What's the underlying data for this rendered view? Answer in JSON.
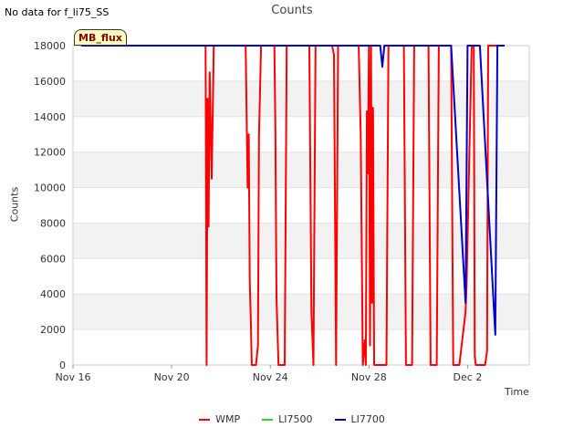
{
  "header": {
    "nodata_text": "No data for f_li75_SS",
    "badge": "MB_flux"
  },
  "colors": {
    "WMP": "#ff0000",
    "LI7500": "#22dd22",
    "LI7700": "#0000cc"
  },
  "chart_data": {
    "type": "line",
    "title": "Counts",
    "xlabel": "Time",
    "ylabel": "Counts",
    "xlim": [
      "2023-11-16",
      "2023-12-04T12:00"
    ],
    "ylim": [
      0,
      18000
    ],
    "yticks": [
      0,
      2000,
      4000,
      6000,
      8000,
      10000,
      12000,
      14000,
      16000,
      18000
    ],
    "xticks": [
      {
        "value": "2023-11-16",
        "label": "Nov 16"
      },
      {
        "value": "2023-11-20",
        "label": "Nov 20"
      },
      {
        "value": "2023-11-24",
        "label": "Nov 24"
      },
      {
        "value": "2023-11-28",
        "label": "Nov 28"
      },
      {
        "value": "2023-12-02",
        "label": "Dec 2"
      }
    ],
    "grid": "horizontal bands",
    "legend": "bottom",
    "series": [
      {
        "name": "WMP",
        "points": [
          [
            "2023-11-16T08:00",
            18000
          ],
          [
            "2023-11-21T09:00",
            18000
          ],
          [
            "2023-11-21T10:00",
            0
          ],
          [
            "2023-11-21T11:00",
            15000
          ],
          [
            "2023-11-21T12:00",
            7800
          ],
          [
            "2023-11-21T13:00",
            16500
          ],
          [
            "2023-11-21T15:00",
            10500
          ],
          [
            "2023-11-21T17:00",
            18000
          ],
          [
            "2023-11-23T00:00",
            18000
          ],
          [
            "2023-11-23T02:00",
            10000
          ],
          [
            "2023-11-23T03:00",
            13000
          ],
          [
            "2023-11-23T04:00",
            4700
          ],
          [
            "2023-11-23T05:00",
            2700
          ],
          [
            "2023-11-23T06:00",
            0
          ],
          [
            "2023-11-23T10:00",
            0
          ],
          [
            "2023-11-23T12:00",
            1100
          ],
          [
            "2023-11-23T13:00",
            12800
          ],
          [
            "2023-11-23T15:00",
            18000
          ],
          [
            "2023-11-24T04:00",
            18000
          ],
          [
            "2023-11-24T05:00",
            13200
          ],
          [
            "2023-11-24T06:00",
            3800
          ],
          [
            "2023-11-24T08:00",
            0
          ],
          [
            "2023-11-24T14:00",
            0
          ],
          [
            "2023-11-24T16:00",
            18000
          ],
          [
            "2023-11-25T14:00",
            18000
          ],
          [
            "2023-11-25T16:00",
            3000
          ],
          [
            "2023-11-25T18:00",
            0
          ],
          [
            "2023-11-25T20:00",
            18000
          ],
          [
            "2023-11-26T12:00",
            18000
          ],
          [
            "2023-11-26T14:00",
            17500
          ],
          [
            "2023-11-26T16:00",
            0
          ],
          [
            "2023-11-26T18:00",
            18000
          ],
          [
            "2023-11-27T14:00",
            18000
          ],
          [
            "2023-11-27T16:00",
            13000
          ],
          [
            "2023-11-27T18:00",
            0
          ],
          [
            "2023-11-27T20:00",
            1400
          ],
          [
            "2023-11-27T21:00",
            0
          ],
          [
            "2023-11-27T22:00",
            14300
          ],
          [
            "2023-11-27T23:00",
            10800
          ],
          [
            "2023-11-28T00:00",
            18000
          ],
          [
            "2023-11-28T01:00",
            1100
          ],
          [
            "2023-11-28T02:00",
            18000
          ],
          [
            "2023-11-28T03:00",
            3500
          ],
          [
            "2023-11-28T04:00",
            14500
          ],
          [
            "2023-11-28T05:00",
            0
          ],
          [
            "2023-11-28T17:00",
            0
          ],
          [
            "2023-11-28T19:00",
            18000
          ],
          [
            "2023-11-29T10:00",
            18000
          ],
          [
            "2023-11-29T12:00",
            0
          ],
          [
            "2023-11-29T18:00",
            0
          ],
          [
            "2023-11-29T20:00",
            18000
          ],
          [
            "2023-11-30T10:00",
            18000
          ],
          [
            "2023-11-30T12:00",
            0
          ],
          [
            "2023-11-30T18:00",
            0
          ],
          [
            "2023-11-30T20:00",
            18000
          ],
          [
            "2023-12-01T08:00",
            18000
          ],
          [
            "2023-12-01T10:00",
            0
          ],
          [
            "2023-12-01T16:00",
            0
          ],
          [
            "2023-12-01T22:00",
            3000
          ],
          [
            "2023-12-01T23:00",
            4500
          ],
          [
            "2023-12-02T04:00",
            18000
          ],
          [
            "2023-12-02T06:00",
            18000
          ],
          [
            "2023-12-02T07:00",
            500
          ],
          [
            "2023-12-02T08:00",
            0
          ],
          [
            "2023-12-02T17:00",
            0
          ],
          [
            "2023-12-02T19:00",
            800
          ],
          [
            "2023-12-02T20:00",
            18000
          ],
          [
            "2023-12-03T12:00",
            18000
          ]
        ]
      },
      {
        "name": "LI7500",
        "points": []
      },
      {
        "name": "LI7700",
        "points": [
          [
            "2023-11-16T08:00",
            18000
          ],
          [
            "2023-11-28T11:00",
            18000
          ],
          [
            "2023-11-28T13:00",
            16800
          ],
          [
            "2023-11-28T15:00",
            18000
          ],
          [
            "2023-12-01T08:00",
            18000
          ],
          [
            "2023-12-01T22:00",
            3500
          ],
          [
            "2023-12-02T00:00",
            18000
          ],
          [
            "2023-12-02T12:00",
            18000
          ],
          [
            "2023-12-03T03:00",
            1700
          ],
          [
            "2023-12-03T05:00",
            18000
          ],
          [
            "2023-12-03T12:00",
            18000
          ]
        ]
      }
    ]
  }
}
